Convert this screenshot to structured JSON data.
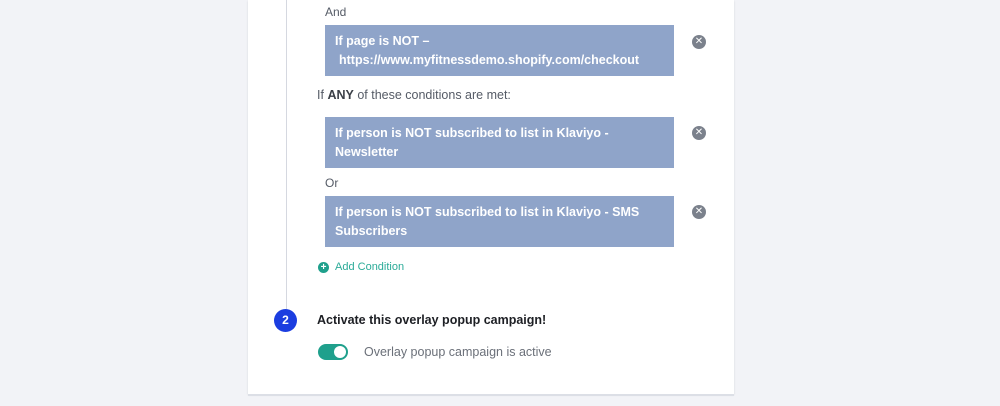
{
  "conditions_all": {
    "connector": "And",
    "items": [
      {
        "line1": "If page is NOT –",
        "line2": "https://www.myfitnessdemo.shopify.com/checkout"
      }
    ]
  },
  "conditions_any": {
    "prefix": "If",
    "keyword": "ANY",
    "suffix": "of these conditions are met:",
    "connector": "Or",
    "items": [
      {
        "line1": "If person is NOT subscribed to list in Klaviyo -",
        "line2": "Newsletter"
      },
      {
        "line1": "If person is NOT subscribed to list in Klaviyo - SMS",
        "line2": "Subscribers"
      }
    ]
  },
  "remove_glyph": "✕",
  "add_condition": {
    "icon_glyph": "+",
    "label": "Add Condition"
  },
  "step2": {
    "number": "2",
    "title": "Activate this overlay popup campaign!",
    "toggle_label": "Overlay popup campaign is active",
    "toggle_on": true
  },
  "colors": {
    "condition_bg": "#8fa4c9",
    "accent_teal": "#1fa08c",
    "step_badge": "#1b3de0",
    "remove_icon": "#7b818c"
  },
  "icons": {
    "remove": "close-circle-icon",
    "add": "plus-circle-icon"
  }
}
